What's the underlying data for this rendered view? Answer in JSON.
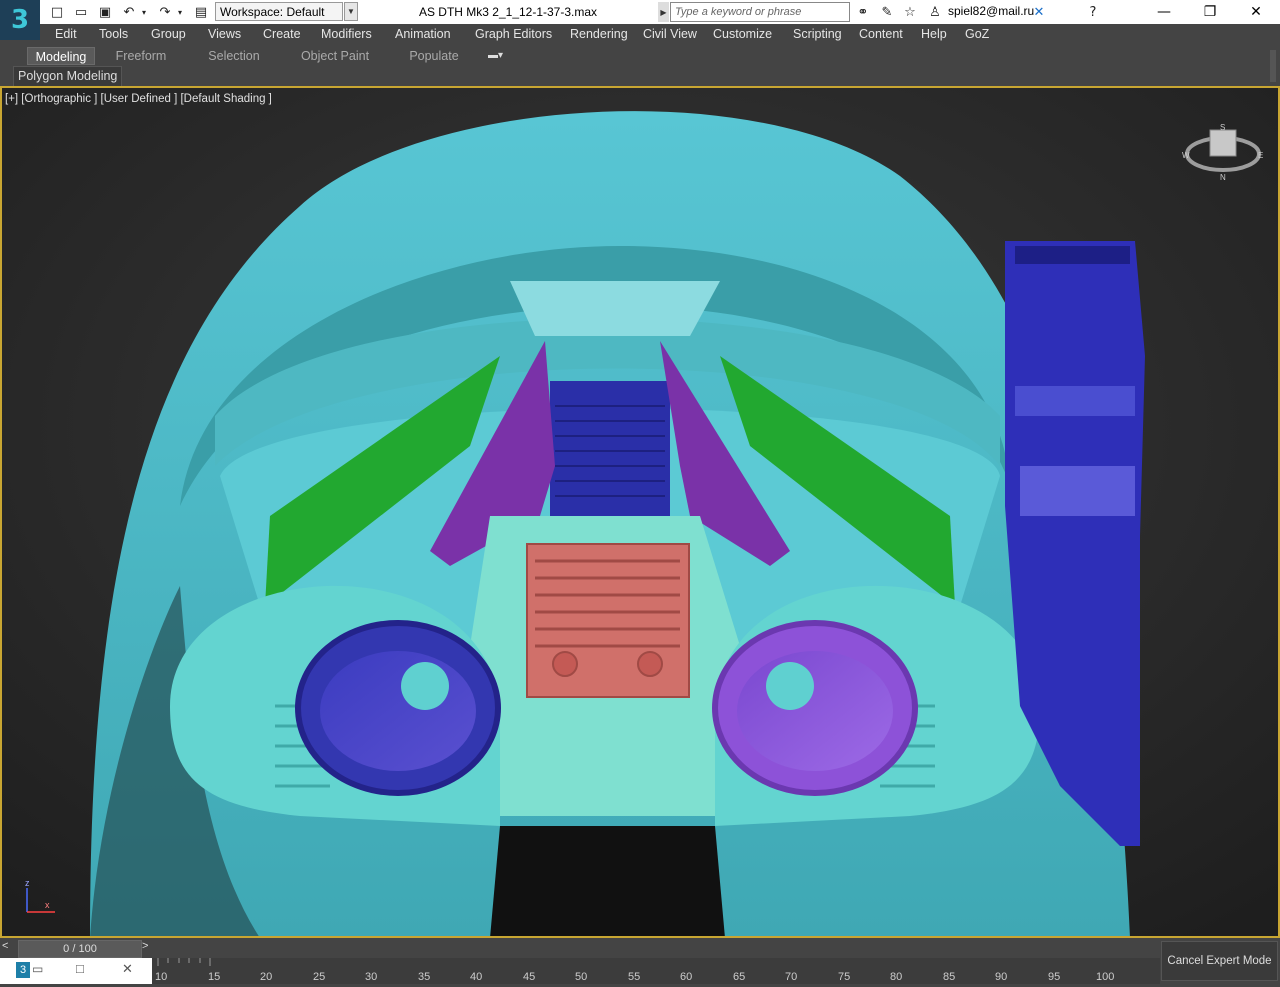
{
  "app": {
    "logo_text": "3",
    "file_title": "AS DTH Mk3 2_1_12-1-37-3.max",
    "workspace_label": "Workspace: Default",
    "search_placeholder": "Type a keyword or phrase",
    "user": "spiel82@mail.ru"
  },
  "menu": [
    "Edit",
    "Tools",
    "Group",
    "Views",
    "Create",
    "Modifiers",
    "Animation",
    "Graph Editors",
    "Rendering",
    "Civil View",
    "Customize",
    "Scripting",
    "Content",
    "Help",
    "GoZ"
  ],
  "ribbon": {
    "tabs": [
      "Modeling",
      "Freeform",
      "Selection",
      "Object Paint",
      "Populate"
    ],
    "active_tab": "Modeling",
    "panel_label": "Polygon Modeling"
  },
  "viewport": {
    "label": "[+] [Orthographic ] [User Defined ] [Default Shading ]",
    "viewcube": {
      "top": "S",
      "left": "W",
      "right": "E",
      "bottom": "N"
    },
    "axis": {
      "z": "z",
      "x": "x"
    },
    "colors": {
      "helmet": "#4fc0c8",
      "visor": "#2e2fa6",
      "purple": "#7a32a8",
      "green": "#22a830",
      "panel": "#d0706a",
      "border": "#c8a632"
    }
  },
  "timeline": {
    "frame_display": "0 / 100",
    "prev": "<",
    "next": ">",
    "ticks": [
      "10",
      "15",
      "20",
      "25",
      "30",
      "35",
      "40",
      "45",
      "50",
      "55",
      "60",
      "65",
      "70",
      "75",
      "80",
      "85",
      "90",
      "95",
      "100"
    ]
  },
  "status": {
    "cancel_expert": "Cancel Expert Mode"
  }
}
